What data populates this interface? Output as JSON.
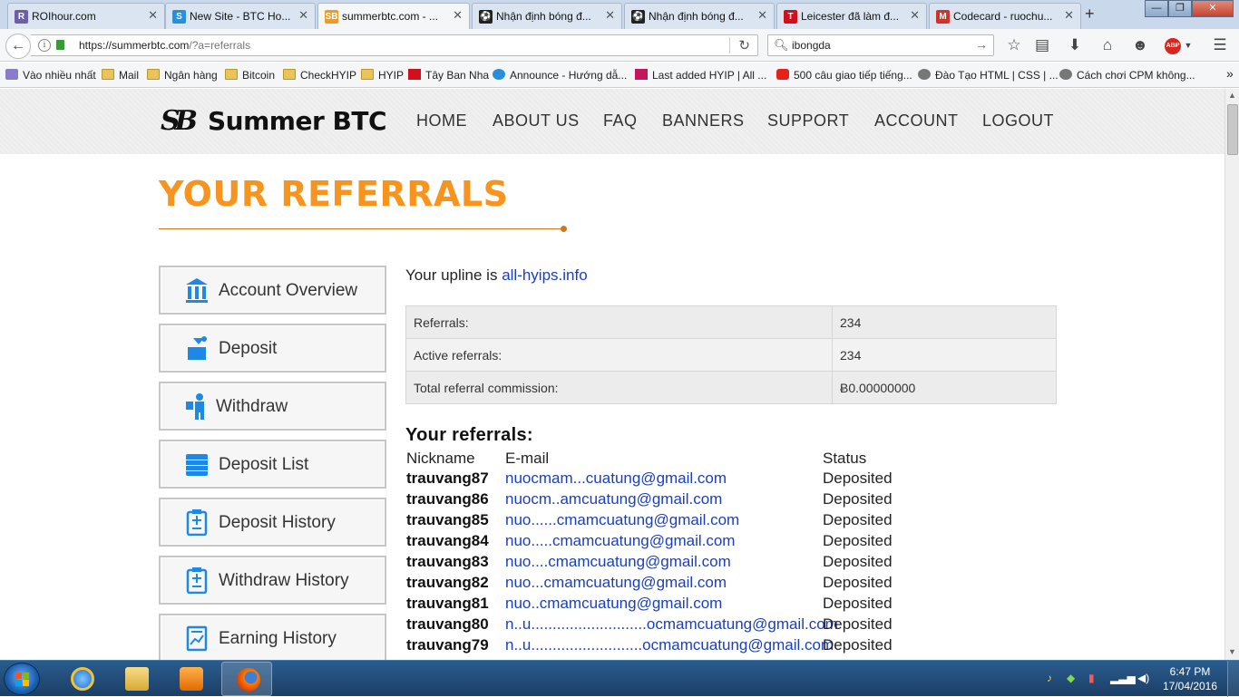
{
  "browser": {
    "tabs": [
      {
        "title": "ROIhour.com",
        "fav": "R",
        "color": "#6b5fa5"
      },
      {
        "title": "New Site - BTC Ho...",
        "fav": "S",
        "color": "#2a8fd6"
      },
      {
        "title": "summerbtc.com - ...",
        "fav": "SB",
        "color": "#f29a1f"
      },
      {
        "title": "Nhận định bóng đ...",
        "fav": "⚽",
        "color": "#222"
      },
      {
        "title": "Nhận định bóng đ...",
        "fav": "⚽",
        "color": "#222"
      },
      {
        "title": "Leicester đã làm đ...",
        "fav": "T",
        "color": "#d0101b"
      },
      {
        "title": "Codecard - ruochu...",
        "fav": "M",
        "color": "#d93025"
      }
    ],
    "new_tab": "+",
    "window_buttons": [
      "—",
      "❐",
      "✕"
    ],
    "url_host": "https://summerbtc.com",
    "url_rest": "/?a=referrals",
    "search_value": "ibongda",
    "bookmarks": [
      {
        "label": "Vào nhiều nhất",
        "type": "star"
      },
      {
        "label": "Mail",
        "type": "folder"
      },
      {
        "label": "Ngân hàng",
        "type": "folder"
      },
      {
        "label": "Bitcoin",
        "type": "folder"
      },
      {
        "label": "CheckHYIP",
        "type": "folder"
      },
      {
        "label": "HYIP",
        "type": "folder"
      },
      {
        "label": "Tây Ban Nha",
        "type": "T"
      },
      {
        "label": "Announce - Hướng dẫ...",
        "type": "S"
      },
      {
        "label": "Last added HYIP | All ...",
        "type": "a"
      },
      {
        "label": "500 câu giao tiếp tiếng...",
        "type": "yt"
      },
      {
        "label": "Đào Tạo HTML | CSS | ...",
        "type": "globe"
      },
      {
        "label": "Cách chơi CPM không...",
        "type": "globe"
      }
    ],
    "bookmarks_more": "»"
  },
  "site": {
    "logo_mark": "SB",
    "logo_text": "Summer BTC",
    "nav": [
      "HOME",
      "ABOUT US",
      "FAQ",
      "BANNERS",
      "SUPPORT",
      "ACCOUNT",
      "LOGOUT"
    ],
    "page_title": "YOUR REFERRALS",
    "sidebar": [
      {
        "label": "Account Overview",
        "icon": "bank-icon"
      },
      {
        "label": "Deposit",
        "icon": "deposit-icon"
      },
      {
        "label": "Withdraw",
        "icon": "withdraw-icon"
      },
      {
        "label": "Deposit List",
        "icon": "list-icon"
      },
      {
        "label": "Deposit History",
        "icon": "clipboard-icon"
      },
      {
        "label": "Withdraw History",
        "icon": "clipboard-icon"
      },
      {
        "label": "Earning History",
        "icon": "chart-doc-icon"
      }
    ],
    "upline_prefix": "Your upline is",
    "upline_link": "all-hyips.info",
    "stats": [
      {
        "label": "Referrals:",
        "value": "234"
      },
      {
        "label": "Active referrals:",
        "value": "234"
      },
      {
        "label": "Total referral commission:",
        "value": "Ƀ0.00000000"
      }
    ],
    "referrals_title": "Your referrals:",
    "referral_headers": [
      "Nickname",
      "E-mail",
      "Status"
    ],
    "referrals": [
      {
        "nick": "trauvang87",
        "email": "nuocmam...cuatung@gmail.com",
        "status": "Deposited"
      },
      {
        "nick": "trauvang86",
        "email": "nuocm..amcuatung@gmail.com",
        "status": "Deposited"
      },
      {
        "nick": "trauvang85",
        "email": "nuo......cmamcuatung@gmail.com",
        "status": "Deposited"
      },
      {
        "nick": "trauvang84",
        "email": "nuo.....cmamcuatung@gmail.com",
        "status": "Deposited"
      },
      {
        "nick": "trauvang83",
        "email": "nuo....cmamcuatung@gmail.com",
        "status": "Deposited"
      },
      {
        "nick": "trauvang82",
        "email": "nuo...cmamcuatung@gmail.com",
        "status": "Deposited"
      },
      {
        "nick": "trauvang81",
        "email": "nuo..cmamcuatung@gmail.com",
        "status": "Deposited"
      },
      {
        "nick": "trauvang80",
        "email": "n..u...........................ocmamcuatung@gmail.com",
        "status": "Deposited"
      },
      {
        "nick": "trauvang79",
        "email": "n..u..........................ocmamcuatung@gmail.com",
        "status": "Deposited"
      }
    ]
  },
  "taskbar": {
    "time": "6:47 PM",
    "date": "17/04/2016"
  }
}
